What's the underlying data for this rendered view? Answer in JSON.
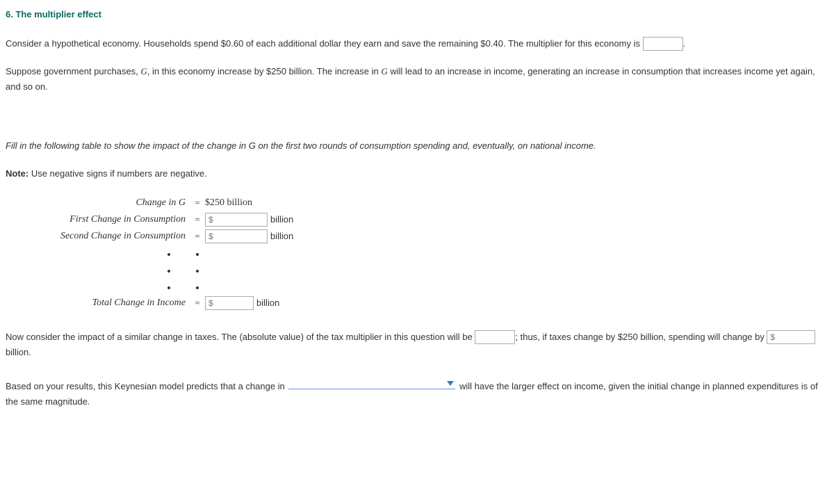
{
  "title": "6. The multiplier effect",
  "p1": {
    "t1": "Consider a hypothetical economy. Households spend $0.60 of each additional dollar they earn and save the remaining $0.40. The multiplier for this economy is ",
    "t2": "."
  },
  "p2": {
    "t1": "Suppose government purchases, ",
    "g": "G",
    "t2": ", in this economy increase by $250 billion. The increase in ",
    "t3": " will lead to an increase in income, generating an increase in consumption that increases income yet again, and so on."
  },
  "p3": {
    "t1": "Fill in the following table to show the impact of the change in ",
    "g": "G",
    "t2": " on the first two rounds of consumption spending and, eventually, on national income."
  },
  "note": {
    "label": "Note:",
    "text": " Use negative signs if numbers are negative."
  },
  "eq": {
    "r1": {
      "label": "Change in G",
      "val": "$250 billion"
    },
    "r2": {
      "label": "First Change in Consumption",
      "ph": "$",
      "unit": "billion"
    },
    "r3": {
      "label": "Second Change in Consumption",
      "ph": "$",
      "unit": "billion"
    },
    "r4": {
      "label": "Total Change in Income",
      "ph": "$",
      "unit": "billion"
    }
  },
  "p4": {
    "t1": "Now consider the impact of a similar change in taxes. The (absolute value) of the tax multiplier in this question will be ",
    "t2": "; thus, if taxes change by $250 billion, spending will change by ",
    "ph": "$",
    "t3": " billion."
  },
  "p5": {
    "t1": "Based on your results, this Keynesian model predicts that a change in ",
    "t2": " will have the larger effect on income, given the initial change in planned expenditures is of the same magnitude."
  }
}
